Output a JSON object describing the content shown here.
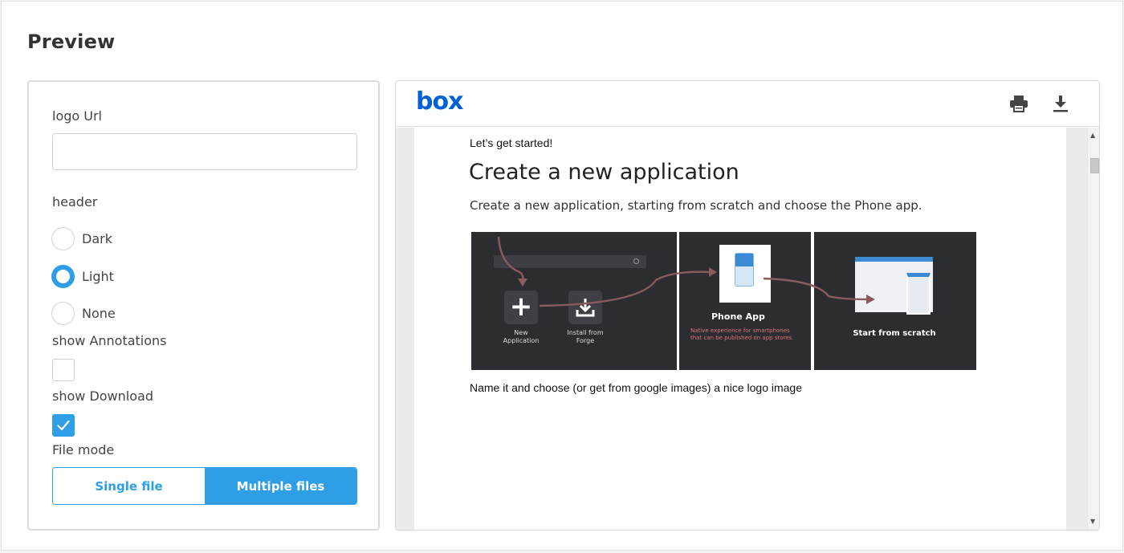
{
  "page": {
    "title": "Preview"
  },
  "settings": {
    "logo_url_label": "logo Url",
    "logo_url_value": "",
    "header_label": "header",
    "header_options": [
      "Dark",
      "Light",
      "None"
    ],
    "header_selected": "Light",
    "annotations_label": "show Annotations",
    "annotations_checked": false,
    "download_label": "show Download",
    "download_checked": true,
    "file_mode_label": "File mode",
    "file_mode_options": [
      "Single file",
      "Multiple files"
    ],
    "file_mode_selected": "Multiple files"
  },
  "viewer": {
    "logo_text": "box",
    "icons": [
      "print-icon",
      "download-icon"
    ],
    "document": {
      "kicker": "Let’s get started!",
      "title": "Create a new application",
      "subtitle": "Create a new application, starting from scratch and choose the Phone app.",
      "caption": "Name it and choose (or get from google images) a nice logo image",
      "screenshot": {
        "new_application": "New\nApplication",
        "install_from_forge": "Install from\nForge",
        "phone_app_title": "Phone App",
        "phone_app_desc": "Native experience for smartphones that can be published on app stores.",
        "start_from_scratch": "Start from scratch"
      }
    }
  },
  "colors": {
    "accent": "#2e9ee6",
    "box_brand": "#0061d5"
  }
}
